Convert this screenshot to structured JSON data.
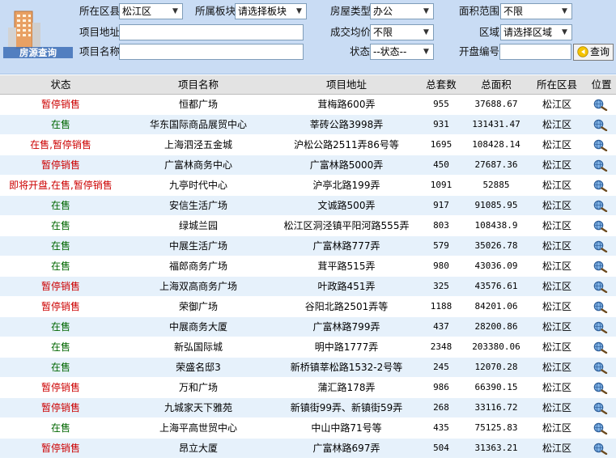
{
  "filters": {
    "district_label": "所在区县",
    "district_value": "松江区",
    "block_label": "所属板块",
    "block_value": "请选择板块",
    "house_type_label": "房屋类型",
    "house_type_value": "办公",
    "area_range_label": "面积范围",
    "area_range_value": "不限",
    "project_address_label": "项目地址",
    "project_address_value": "",
    "avg_price_label": "成交均价",
    "avg_price_value": "不限",
    "region_label": "区域",
    "region_value": "请选择区域",
    "project_name_label": "项目名称",
    "project_name_value": "",
    "status_label": "状态",
    "status_value": "--状态--",
    "opening_no_label": "开盘编号",
    "opening_no_value": "",
    "query_button": "查询",
    "logo_text": "房源查询"
  },
  "table": {
    "headers": [
      "状态",
      "项目名称",
      "项目地址",
      "总套数",
      "总面积",
      "所在区县",
      "位置"
    ],
    "rows": [
      {
        "status": "暂停销售",
        "status_color": "red",
        "name": "恒都广场",
        "address": "茸梅路600弄",
        "units": "955",
        "area": "37688.67",
        "district": "松江区"
      },
      {
        "status": "在售",
        "status_color": "green",
        "name": "华东国际商品展贸中心",
        "address": "莘砖公路3998弄",
        "units": "931",
        "area": "131431.47",
        "district": "松江区"
      },
      {
        "status": "在售,暂停销售",
        "status_color": "red",
        "name": "上海泗泾五金城",
        "address": "沪松公路2511弄86号等",
        "units": "1695",
        "area": "108428.14",
        "district": "松江区"
      },
      {
        "status": "暂停销售",
        "status_color": "red",
        "name": "广富林商务中心",
        "address": "广富林路5000弄",
        "units": "450",
        "area": "27687.36",
        "district": "松江区"
      },
      {
        "status": "即将开盘,在售,暂停销售",
        "status_color": "red",
        "name": "九亭时代中心",
        "address": "沪亭北路199弄",
        "units": "1091",
        "area": "52885",
        "district": "松江区"
      },
      {
        "status": "在售",
        "status_color": "green",
        "name": "安信生活广场",
        "address": "文诚路500弄",
        "units": "917",
        "area": "91085.95",
        "district": "松江区"
      },
      {
        "status": "在售",
        "status_color": "green",
        "name": "绿城兰园",
        "address": "松江区洞泾镇平阳河路555弄",
        "units": "803",
        "area": "108438.9",
        "district": "松江区"
      },
      {
        "status": "在售",
        "status_color": "green",
        "name": "中展生活广场",
        "address": "广富林路777弄",
        "units": "579",
        "area": "35026.78",
        "district": "松江区"
      },
      {
        "status": "在售",
        "status_color": "green",
        "name": "福郎商务广场",
        "address": "茸平路515弄",
        "units": "980",
        "area": "43036.09",
        "district": "松江区"
      },
      {
        "status": "暂停销售",
        "status_color": "red",
        "name": "上海双高商务广场",
        "address": "叶政路451弄",
        "units": "325",
        "area": "43576.61",
        "district": "松江区"
      },
      {
        "status": "暂停销售",
        "status_color": "red",
        "name": "荣御广场",
        "address": "谷阳北路2501弄等",
        "units": "1188",
        "area": "84201.06",
        "district": "松江区"
      },
      {
        "status": "在售",
        "status_color": "green",
        "name": "中展商务大厦",
        "address": "广富林路799弄",
        "units": "437",
        "area": "28200.86",
        "district": "松江区"
      },
      {
        "status": "在售",
        "status_color": "green",
        "name": "新弘国际城",
        "address": "明中路1777弄",
        "units": "2348",
        "area": "203380.06",
        "district": "松江区"
      },
      {
        "status": "在售",
        "status_color": "green",
        "name": "荣盛名邸3",
        "address": "新桥镇莘松路1532-2号等",
        "units": "245",
        "area": "12070.28",
        "district": "松江区"
      },
      {
        "status": "暂停销售",
        "status_color": "red",
        "name": "万和广场",
        "address": "蒲汇路178弄",
        "units": "986",
        "area": "66390.15",
        "district": "松江区"
      },
      {
        "status": "暂停销售",
        "status_color": "red",
        "name": "九城家天下雅苑",
        "address": "新镇街99弄、新镇街59弄",
        "units": "268",
        "area": "33116.72",
        "district": "松江区"
      },
      {
        "status": "在售",
        "status_color": "green",
        "name": "上海平高世贸中心",
        "address": "中山中路71号等",
        "units": "435",
        "area": "75125.83",
        "district": "松江区"
      },
      {
        "status": "暂停销售",
        "status_color": "red",
        "name": "昂立大厦",
        "address": "广富林路697弄",
        "units": "504",
        "area": "31363.21",
        "district": "松江区"
      }
    ]
  },
  "icons": {
    "location": "magnifier-globe-icon",
    "query": "arrow-left-icon"
  },
  "colors": {
    "status_red": "#cc0000",
    "status_green": "#006600",
    "panel_bg": "#c9dcf4",
    "row_alt": "#e6f1fb"
  }
}
